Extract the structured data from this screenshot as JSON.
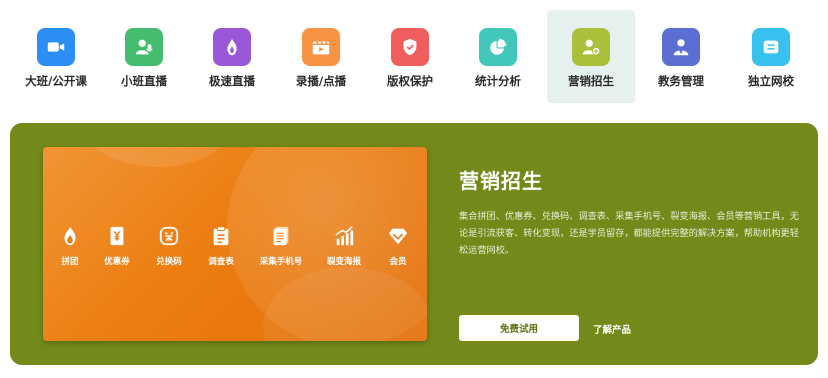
{
  "nav": {
    "items": [
      {
        "label": "大班/公开课",
        "icon": "video-camera-icon",
        "color": "#2b8ef5"
      },
      {
        "label": "小班直播",
        "icon": "user-mic-icon",
        "color": "#45bd6e"
      },
      {
        "label": "极速直播",
        "icon": "flame-icon",
        "color": "#9a58d8"
      },
      {
        "label": "录播/点播",
        "icon": "clapperboard-icon",
        "color": "#f79343"
      },
      {
        "label": "版权保护",
        "icon": "shield-check-icon",
        "color": "#ef5d5d"
      },
      {
        "label": "统计分析",
        "icon": "pie-chart-icon",
        "color": "#43c7bb"
      },
      {
        "label": "营销招生",
        "icon": "user-add-icon",
        "color": "#a9c13a"
      },
      {
        "label": "教务管理",
        "icon": "teacher-icon",
        "color": "#5b6ed2"
      },
      {
        "label": "独立网校",
        "icon": "school-card-icon",
        "color": "#38c0ee"
      }
    ],
    "active_index": 6
  },
  "banner": {
    "background": "#738a1a",
    "promo_gradient": [
      "#f09535",
      "#e3700a"
    ],
    "features": [
      {
        "label": "拼团",
        "icon": "group-buy-flame-icon"
      },
      {
        "label": "优惠券",
        "icon": "coupon-yen-icon"
      },
      {
        "label": "兑换码",
        "icon": "redeem-code-icon"
      },
      {
        "label": "调查表",
        "icon": "clipboard-icon"
      },
      {
        "label": "采集手机号",
        "icon": "document-list-icon"
      },
      {
        "label": "裂变海报",
        "icon": "bar-trend-icon"
      },
      {
        "label": "会员",
        "icon": "diamond-icon"
      }
    ],
    "title": "营销招生",
    "description": "集合拼团、优惠券、兑换码、调查表、采集手机号、裂变海报、会员等营销工具，无论是引流获客、转化变现，还是学员留存，都能提供完整的解决方案，帮助机构更轻松运营网校。",
    "primary_button": "免费试用",
    "secondary_link": "了解产品"
  }
}
